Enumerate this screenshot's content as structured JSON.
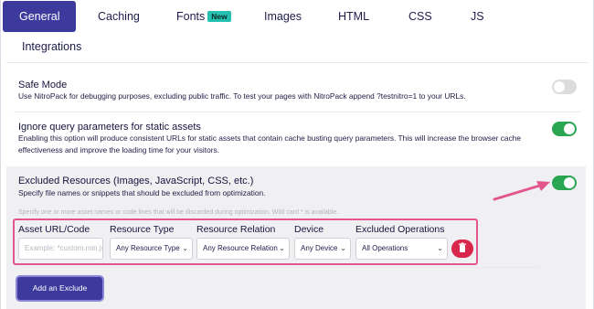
{
  "tabs": [
    {
      "label": "General"
    },
    {
      "label": "Caching"
    },
    {
      "label": "Fonts",
      "badge": "New"
    },
    {
      "label": "Images"
    },
    {
      "label": "HTML"
    },
    {
      "label": "CSS"
    },
    {
      "label": "JS"
    },
    {
      "label": "Integrations"
    }
  ],
  "settings": {
    "safe_mode": {
      "title": "Safe Mode",
      "description": "Use NitroPack for debugging purposes, excluding public traffic. To test your pages with NitroPack append ?testnitro=1 to your URLs.",
      "enabled": false
    },
    "ignore_query": {
      "title": "Ignore query parameters for static assets",
      "description": "Enabling this option will produce consistent URLs for static assets that contain cache busting query parameters. This will increase the browser cache effectiveness and improve the loading time for your visitors.",
      "enabled": true
    },
    "excluded_resources": {
      "title": "Excluded Resources (Images, JavaScript, CSS, etc.)",
      "description": "Specify file names or snippets that should be excluded from optimization.",
      "hint": "Specify one or more asset names or code lines that will be discarded during optimization. Wild card * is available.",
      "enabled": true,
      "columns": [
        "Asset URL/Code",
        "Resource Type",
        "Resource Relation",
        "Device",
        "Excluded Operations"
      ],
      "row": {
        "asset_placeholder": "Example: *custom.min.js",
        "resource_type": "Any Resource Type",
        "resource_relation": "Any Resource Relation",
        "device": "Any Device",
        "excluded_operations": "All Operations"
      },
      "add_button": "Add an Exclude"
    }
  },
  "colors": {
    "accent": "#3d3a9e",
    "toggle_on": "#2aa653",
    "toggle_off": "#dcdcdc",
    "highlight": "#e4578e",
    "delete": "#d9264c",
    "badge": "#25c1b0"
  }
}
